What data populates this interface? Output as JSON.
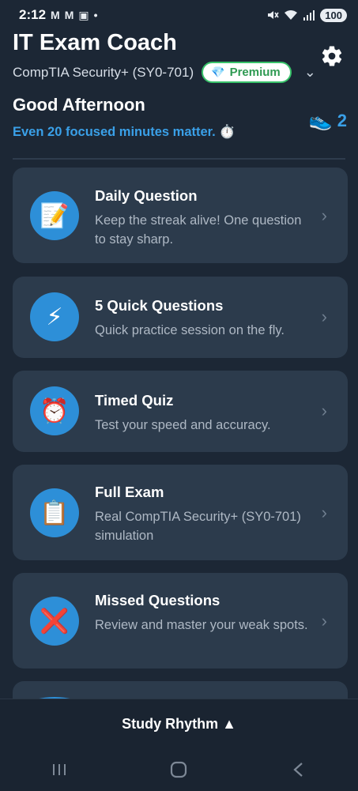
{
  "status": {
    "time": "2:12",
    "notif_icons": [
      "M",
      "M",
      "▣",
      "•"
    ],
    "battery": "100"
  },
  "header": {
    "app_title": "IT Exam Coach",
    "exam_name": "CompTIA Security+ (SY0-701)",
    "premium_label": "Premium",
    "greeting": "Good Afternoon",
    "motivation": "Even 20 focused minutes matter. ⏱️",
    "streak_count": "2"
  },
  "cards": [
    {
      "title": "Daily Question",
      "subtitle": "Keep the streak alive! One question to stay sharp.",
      "icon": "memo-icon",
      "glyph": "📝"
    },
    {
      "title": "5 Quick Questions",
      "subtitle": "Quick practice session on the fly.",
      "icon": "lightning-icon",
      "glyph": "⚡"
    },
    {
      "title": "Timed Quiz",
      "subtitle": "Test your speed and accuracy.",
      "icon": "alarm-clock-icon",
      "glyph": "⏰"
    },
    {
      "title": "Full Exam",
      "subtitle": "Real CompTIA Security+ (SY0-701) simulation",
      "icon": "clipboard-icon",
      "glyph": "📋"
    },
    {
      "title": "Missed Questions",
      "subtitle": "Review and master your weak spots.",
      "icon": "cross-mark-icon",
      "glyph": "❌"
    }
  ],
  "bottom": {
    "label": "Study Rhythm ▲"
  },
  "colors": {
    "background": "#1c2735",
    "card": "#2c3b4c",
    "accent": "#3aa0e8",
    "premium_green": "#38c26a"
  }
}
